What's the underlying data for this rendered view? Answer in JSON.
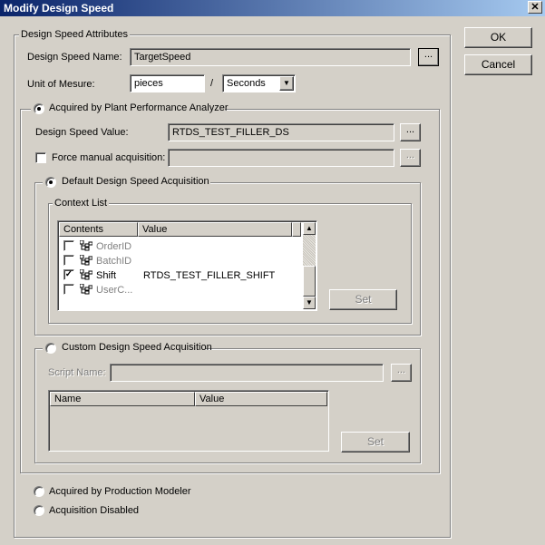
{
  "window": {
    "title": "Modify Design Speed",
    "close_glyph": "✕"
  },
  "buttons": {
    "ok": "OK",
    "cancel": "Cancel",
    "set": "Set",
    "set2": "Set",
    "browse": "...",
    "ellipsis": "..."
  },
  "attributes": {
    "group_label": "Design Speed Attributes",
    "name_label": "Design Speed Name:",
    "name_value": "TargetSpeed",
    "uom_label": "Unit of Mesure:",
    "uom_value": "pieces",
    "uom_separator": "/",
    "time_unit": "Seconds"
  },
  "ppa": {
    "radio_label": "Acquired by Plant Performance Analyzer",
    "value_label": "Design Speed Value:",
    "value": "RTDS_TEST_FILLER_DS",
    "force_label": "Force manual acquisition:",
    "force_value": ""
  },
  "default_acq": {
    "radio_label": "Default Design Speed Acquisition",
    "context_label": "Context List",
    "columns": [
      "Contents",
      "Value"
    ],
    "rows": [
      {
        "name": "OrderID",
        "value": "",
        "checked": false,
        "enabled": false
      },
      {
        "name": "BatchID",
        "value": "",
        "checked": false,
        "enabled": false
      },
      {
        "name": "Shift",
        "value": "RTDS_TEST_FILLER_SHIFT",
        "checked": true,
        "enabled": true
      },
      {
        "name": "UserC...",
        "value": "",
        "checked": false,
        "enabled": false
      }
    ],
    "check_glyph": "✓"
  },
  "custom_acq": {
    "radio_label": "Custom Design Speed Acquisition",
    "script_label": "Script Name:",
    "script_value": "",
    "columns": [
      "Name",
      "Value"
    ]
  },
  "bottom_options": {
    "production_modeler": "Acquired by Production Modeler",
    "disabled": "Acquisition Disabled"
  },
  "icons": {
    "close": "close-icon",
    "dropdown": "chevron-down-icon",
    "tree": "tree-node-icon",
    "scroll_up": "arrow-up-icon",
    "scroll_down": "arrow-down-icon"
  },
  "colors": {
    "titlebar_start": "#0a246a",
    "titlebar_end": "#a6caf0",
    "face": "#d4d0c8"
  }
}
